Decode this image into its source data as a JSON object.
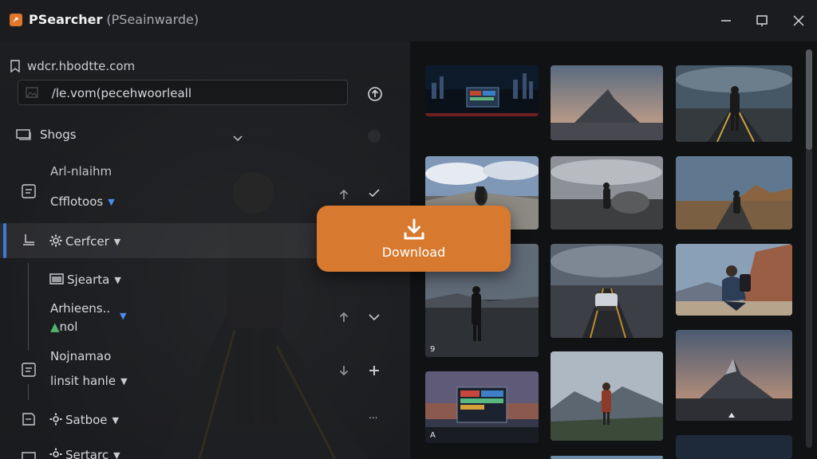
{
  "window": {
    "title": "PSearcher",
    "subtitle": "(PSeainwarde)"
  },
  "sidebar": {
    "site_label": "wdcr.hbodtte.com",
    "url_input": "ﾠ/le.vom(pecehwoorleall",
    "section_title": "Shogs",
    "items": [
      {
        "line1": "Arl-nlaihm",
        "line2": "Cfflotoos"
      },
      {
        "line1": "Cerfcer"
      },
      {
        "line1": "Sjearta"
      },
      {
        "line1": "Arhieens..",
        "line2": "nol"
      },
      {
        "line1": "Nojnamao",
        "line2": "linsit hanle"
      },
      {
        "line1": "Satboe"
      },
      {
        "line1": "Sertarc"
      }
    ],
    "ellipsis": "..."
  },
  "download": {
    "label": "Download"
  },
  "gallery": {
    "thumb_labels": [
      "9",
      "A"
    ]
  },
  "colors": {
    "accent": "#d77a30",
    "selection": "#3d7bd8",
    "background": "#141517"
  }
}
